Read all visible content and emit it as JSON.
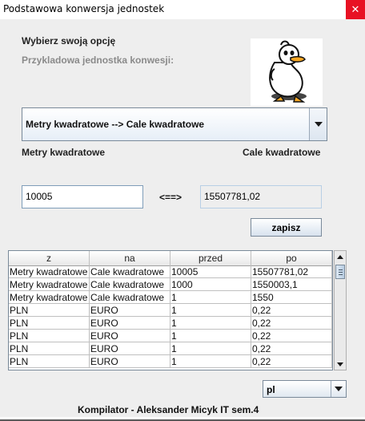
{
  "window": {
    "title": "Podstawowa konwersja jednostek",
    "close_glyph": "✕"
  },
  "options": {
    "heading": "Wybierz swoją opcję",
    "subheading": "Przykladowa jednostka konwesji:"
  },
  "conversion_select": {
    "selected": "Metry kwadratowe --> Cale kwadratowe"
  },
  "from_unit": {
    "label": "Metry kwadratowe",
    "value": "10005"
  },
  "to_unit": {
    "label": "Cale kwadratowe",
    "value": "15507781,02"
  },
  "arrows": "<==>",
  "save_button": {
    "label": "zapisz"
  },
  "history_table": {
    "columns": [
      "z",
      "na",
      "przed",
      "po"
    ],
    "rows": [
      [
        "Metry kwadratowe",
        "Cale kwadratowe",
        "10005",
        "15507781,02"
      ],
      [
        "Metry kwadratowe",
        "Cale kwadratowe",
        "1000",
        "1550003,1"
      ],
      [
        "Metry kwadratowe",
        "Cale kwadratowe",
        "1",
        "1550"
      ],
      [
        "PLN",
        "EURO",
        "1",
        "0,22"
      ],
      [
        "PLN",
        "EURO",
        "1",
        "0,22"
      ],
      [
        "PLN",
        "EURO",
        "1",
        "0,22"
      ],
      [
        "PLN",
        "EURO",
        "1",
        "0,22"
      ],
      [
        "PLN",
        "EURO",
        "1",
        "0,22"
      ]
    ]
  },
  "language_select": {
    "selected": "pl"
  },
  "footer": {
    "text": "Kompilator - Aleksander Micyk IT sem.4"
  },
  "colors": {
    "panel": "#eeeeee",
    "close": "#e81123",
    "field_border": "#7f9db9"
  },
  "icons": {
    "mascot": "duck-mascot-icon"
  }
}
